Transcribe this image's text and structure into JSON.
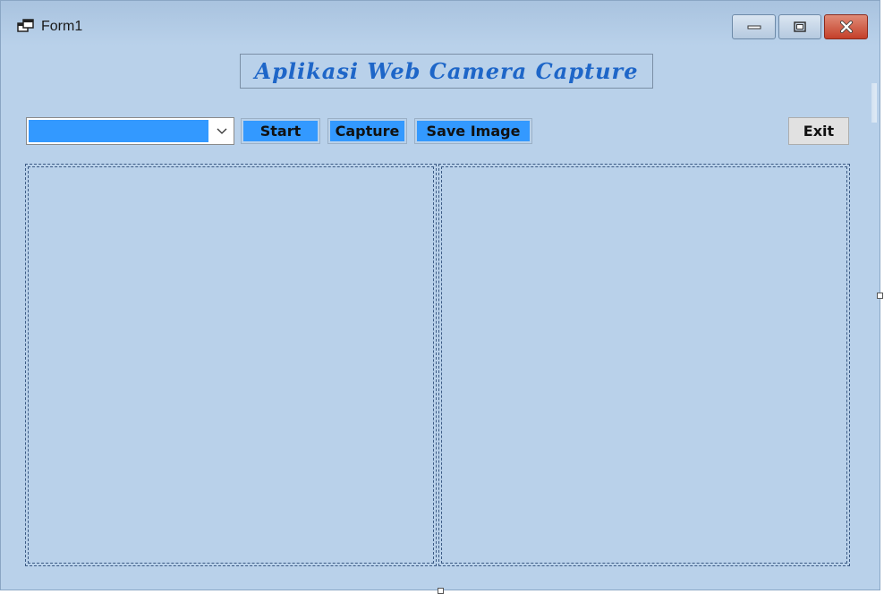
{
  "window": {
    "title": "Form1",
    "icon": "form-window-icon",
    "controls": {
      "minimize_icon": "minimize-icon",
      "maximize_icon": "maximize-icon",
      "close_icon": "close-icon"
    }
  },
  "header": {
    "title": "Aplikasi Web Camera Capture"
  },
  "toolbar": {
    "camera_select_value": "",
    "start_label": "Start",
    "capture_label": "Capture",
    "save_label": "Save Image",
    "exit_label": "Exit"
  },
  "colors": {
    "form_background": "#b9d1ea",
    "accent_blue": "#3399ff",
    "title_text": "#1e66c8",
    "close_button": "#c4402a"
  }
}
